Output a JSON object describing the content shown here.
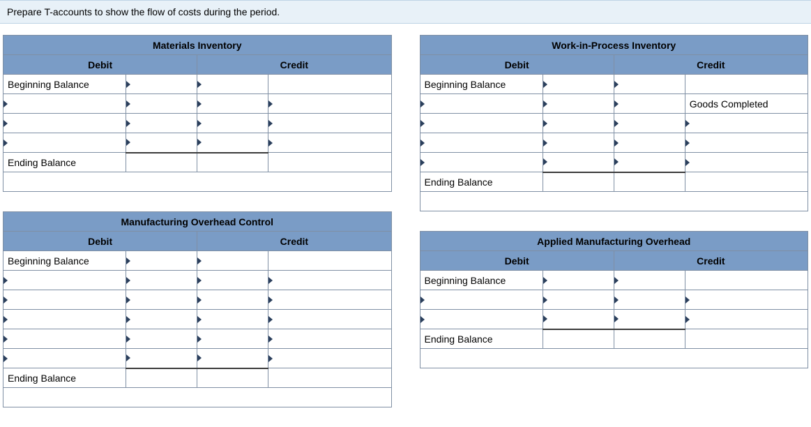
{
  "prompt": "Prepare T-accounts to show the flow of costs during the period.",
  "headers": {
    "debit": "Debit",
    "credit": "Credit"
  },
  "labels": {
    "beginning": "Beginning Balance",
    "ending": "Ending Balance",
    "goods_completed": "Goods Completed"
  },
  "accounts": {
    "materials": {
      "title": "Materials Inventory"
    },
    "wip": {
      "title": "Work-in-Process Inventory"
    },
    "moh_control": {
      "title": "Manufacturing Overhead Control"
    },
    "applied_moh": {
      "title": "Applied Manufacturing Overhead"
    }
  }
}
